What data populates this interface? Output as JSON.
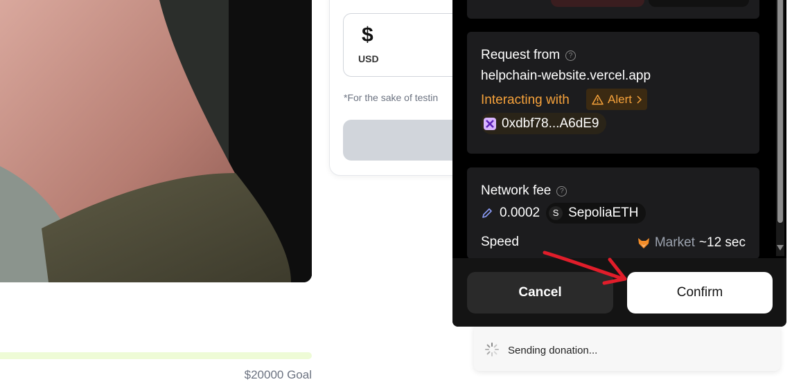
{
  "left": {
    "goal_label": "$20000 Goal",
    "progress_fraction": 0.0
  },
  "donation_card": {
    "currency_symbol": "$",
    "currency_code": "USD",
    "test_note": "*For the sake of testin"
  },
  "wallet": {
    "request_label": "Request from",
    "request_origin": "helpchain-website.vercel.app",
    "interacting_label": "Interacting with",
    "alert_label": "Alert",
    "contract_address": "0xdbf78...A6dE9",
    "fee_label": "Network fee",
    "fee_amount": "0.0002",
    "fee_token_symbol": "S",
    "fee_token": "SepoliaETH",
    "speed_label": "Speed",
    "speed_mode": "Market",
    "speed_time": "~12 sec",
    "cancel_label": "Cancel",
    "confirm_label": "Confirm",
    "colors": {
      "alert": "#f6a23b",
      "background": "#000000",
      "panel": "#1c1c1e"
    }
  },
  "toast": {
    "message": "Sending donation..."
  }
}
